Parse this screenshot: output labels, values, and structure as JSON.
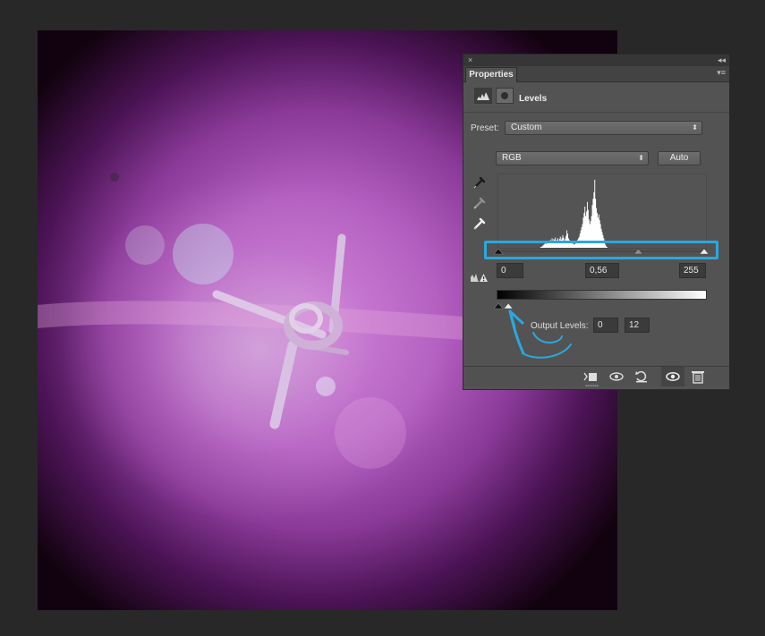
{
  "panel": {
    "close_glyph": "×",
    "collapse_glyph": "◂◂",
    "tab_label": "Properties",
    "menu_glyph": "▾≡",
    "adjustment_icon": "levels-histogram-icon",
    "mask_icon": "layer-mask-icon",
    "adjustment_title": "Levels",
    "preset_label": "Preset:",
    "preset_value": "Custom",
    "channel_value": "RGB",
    "auto_label": "Auto",
    "input_black": "0",
    "input_gamma": "0,56",
    "input_white": "255",
    "output_label": "Output Levels:",
    "output_black": "0",
    "output_white": "12",
    "arrow_glyph": "⬍"
  },
  "eyedroppers": [
    "black-point-eyedropper-icon",
    "gray-point-eyedropper-icon",
    "white-point-eyedropper-icon"
  ],
  "footer_icons": [
    "clip-to-layer-icon",
    "view-previous-state-icon",
    "reset-adjustment-icon",
    "toggle-visibility-icon",
    "delete-adjustment-icon"
  ],
  "slider_levels": {
    "input_black": 0,
    "input_gamma_fraction": 0.68,
    "input_white": 255,
    "output_black": 0,
    "output_white": 12
  },
  "annotation": {
    "highlight_color": "#2aa8de",
    "arrow_color": "#2aa8de"
  },
  "histogram": {
    "bins": [
      0,
      0,
      0,
      0,
      0,
      0,
      0,
      0,
      0,
      0,
      0,
      0,
      0,
      0,
      0,
      0,
      0,
      0,
      0,
      0,
      0,
      0,
      0,
      0,
      0,
      0,
      0,
      0,
      0,
      0,
      0,
      0,
      0,
      0,
      0,
      0,
      0,
      0,
      0,
      0,
      0,
      0,
      0,
      0,
      0,
      0,
      0,
      0,
      0,
      0,
      0,
      1,
      1,
      2,
      3,
      4,
      5,
      6,
      5,
      7,
      8,
      6,
      9,
      10,
      8,
      12,
      9,
      11,
      10,
      13,
      8,
      10,
      12,
      9,
      11,
      14,
      10,
      12,
      16,
      13,
      9,
      11,
      15,
      22,
      18,
      12,
      10,
      9,
      8,
      7,
      6,
      5,
      4,
      5,
      6,
      8,
      10,
      12,
      14,
      18,
      22,
      26,
      30,
      38,
      44,
      52,
      40,
      46,
      58,
      48,
      36,
      30,
      34,
      40,
      54,
      62,
      70,
      86,
      62,
      50,
      44,
      38,
      42,
      35,
      30,
      24,
      20,
      16,
      12,
      8,
      4,
      2,
      1,
      0,
      0,
      0,
      0,
      0,
      0,
      0,
      0,
      0,
      0,
      0,
      0,
      0,
      0,
      0,
      0,
      0,
      0,
      0,
      0,
      0,
      0,
      0,
      0,
      0,
      0,
      0,
      0,
      0,
      0,
      0,
      0,
      0,
      0,
      0,
      0,
      0,
      0,
      0,
      0,
      0,
      0,
      0,
      0,
      0,
      0,
      0,
      0,
      0,
      0,
      0,
      0,
      0,
      0,
      0,
      0,
      0,
      0,
      0,
      0,
      0,
      0,
      0,
      0,
      0,
      0,
      0,
      0,
      0,
      0,
      0,
      0,
      0,
      0,
      0,
      0,
      0,
      0,
      0,
      0,
      0,
      0,
      0,
      0,
      0,
      0,
      0,
      0,
      0,
      0,
      0,
      0,
      0,
      0,
      0,
      0,
      0,
      0,
      0,
      0,
      0,
      0,
      0,
      0,
      0,
      0,
      0,
      0,
      0,
      0,
      0,
      0,
      0,
      0,
      0,
      0,
      0,
      0,
      0,
      0
    ]
  }
}
